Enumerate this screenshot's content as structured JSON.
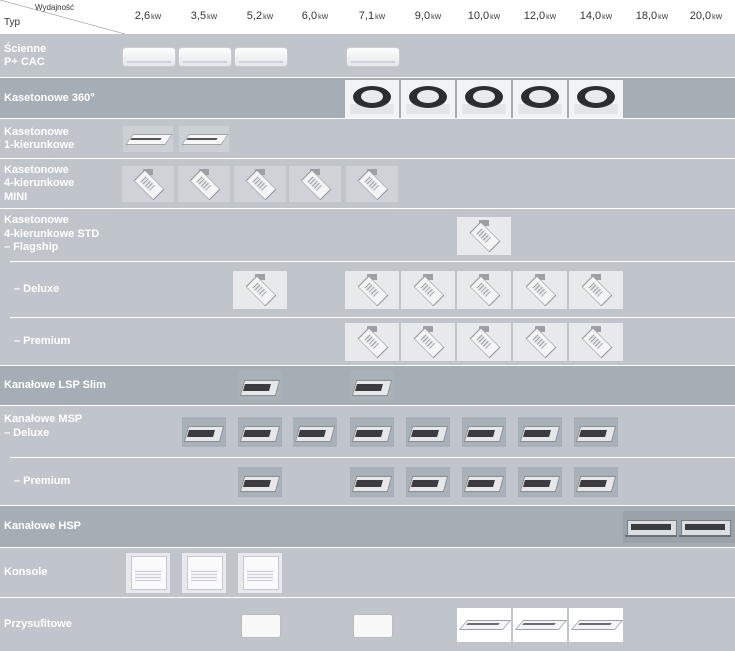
{
  "header": {
    "capacity_label": "Wydajność",
    "type_label": "Typ",
    "capacities": [
      {
        "value": "2,6",
        "unit": "kW"
      },
      {
        "value": "3,5",
        "unit": "kW"
      },
      {
        "value": "5,2",
        "unit": "kW"
      },
      {
        "value": "6,0",
        "unit": "kW"
      },
      {
        "value": "7,1",
        "unit": "kW"
      },
      {
        "value": "9,0",
        "unit": "kW"
      },
      {
        "value": "10,0",
        "unit": "kW"
      },
      {
        "value": "12,0",
        "unit": "kW"
      },
      {
        "value": "14,0",
        "unit": "kW"
      },
      {
        "value": "18,0",
        "unit": "kW"
      },
      {
        "value": "20,0",
        "unit": "kW"
      }
    ]
  },
  "rows": [
    {
      "label": "Ścienne\nP+ CAC",
      "kind": "wall",
      "icon": "wall-unit-icon",
      "sizes": [
        "2,6",
        "3,5",
        "5,2",
        "7,1"
      ]
    },
    {
      "label": "Kasetonowe 360°",
      "kind": "cas360",
      "icon": "cassette-360-icon",
      "sizes": [
        "7,1",
        "9,0",
        "10,0",
        "12,0",
        "14,0"
      ]
    },
    {
      "label": "Kasetonowe\n1-kierunkowe",
      "kind": "one",
      "icon": "cassette-1way-icon",
      "sizes": [
        "2,6",
        "3,5"
      ]
    },
    {
      "label": "Kasetonowe\n4-kierunkowe\nMINI",
      "kind": "four",
      "icon": "cassette-4way-mini-icon",
      "sizes": [
        "2,6",
        "3,5",
        "5,2",
        "6,0",
        "7,1"
      ]
    },
    {
      "label": "Kasetonowe\n4-kierunkowe STD\n  – Flagship",
      "kind": "fourbig",
      "icon": "cassette-4way-std-icon",
      "sizes": [
        "10,0"
      ]
    },
    {
      "label": "– Deluxe",
      "sub": true,
      "kind": "fourbig",
      "icon": "cassette-4way-std-icon",
      "sizes": [
        "5,2",
        "7,1",
        "9,0",
        "10,0",
        "12,0",
        "14,0"
      ]
    },
    {
      "label": "– Premium",
      "sub": true,
      "kind": "fourbig",
      "icon": "cassette-4way-std-icon",
      "sizes": [
        "7,1",
        "9,0",
        "10,0",
        "12,0",
        "14,0"
      ]
    },
    {
      "label": "Kanałowe LSP Slim",
      "kind": "duct",
      "icon": "duct-unit-icon",
      "sizes": [
        "5,2",
        "7,1"
      ]
    },
    {
      "label": "Kanałowe MSP\n  – Deluxe",
      "kind": "duct",
      "icon": "duct-unit-icon",
      "sizes": [
        "3,5",
        "5,2",
        "6,0",
        "7,1",
        "9,0",
        "10,0",
        "12,0",
        "14,0"
      ]
    },
    {
      "label": "– Premium",
      "sub": true,
      "kind": "duct",
      "icon": "duct-unit-icon",
      "sizes": [
        "5,2",
        "7,1",
        "9,0",
        "10,0",
        "12,0",
        "14,0"
      ]
    },
    {
      "label": "Kanałowe HSP",
      "kind": "hsp",
      "icon": "duct-hsp-icon",
      "sizes": [
        "18,0",
        "20,0"
      ]
    },
    {
      "label": "Konsole",
      "kind": "console",
      "icon": "console-unit-icon",
      "sizes": [
        "2,6",
        "3,5",
        "5,2"
      ]
    },
    {
      "label": "Przysufitowe",
      "kind": "ceilmix",
      "icon": "ceiling-unit-icon",
      "sizes": [
        "5,2",
        "7,1",
        "10,0",
        "12,0",
        "14,0"
      ]
    }
  ],
  "colors": {
    "band_light": "#bfc5cb",
    "band_dark": "#a5adb5",
    "label_text": "#ffffff"
  }
}
